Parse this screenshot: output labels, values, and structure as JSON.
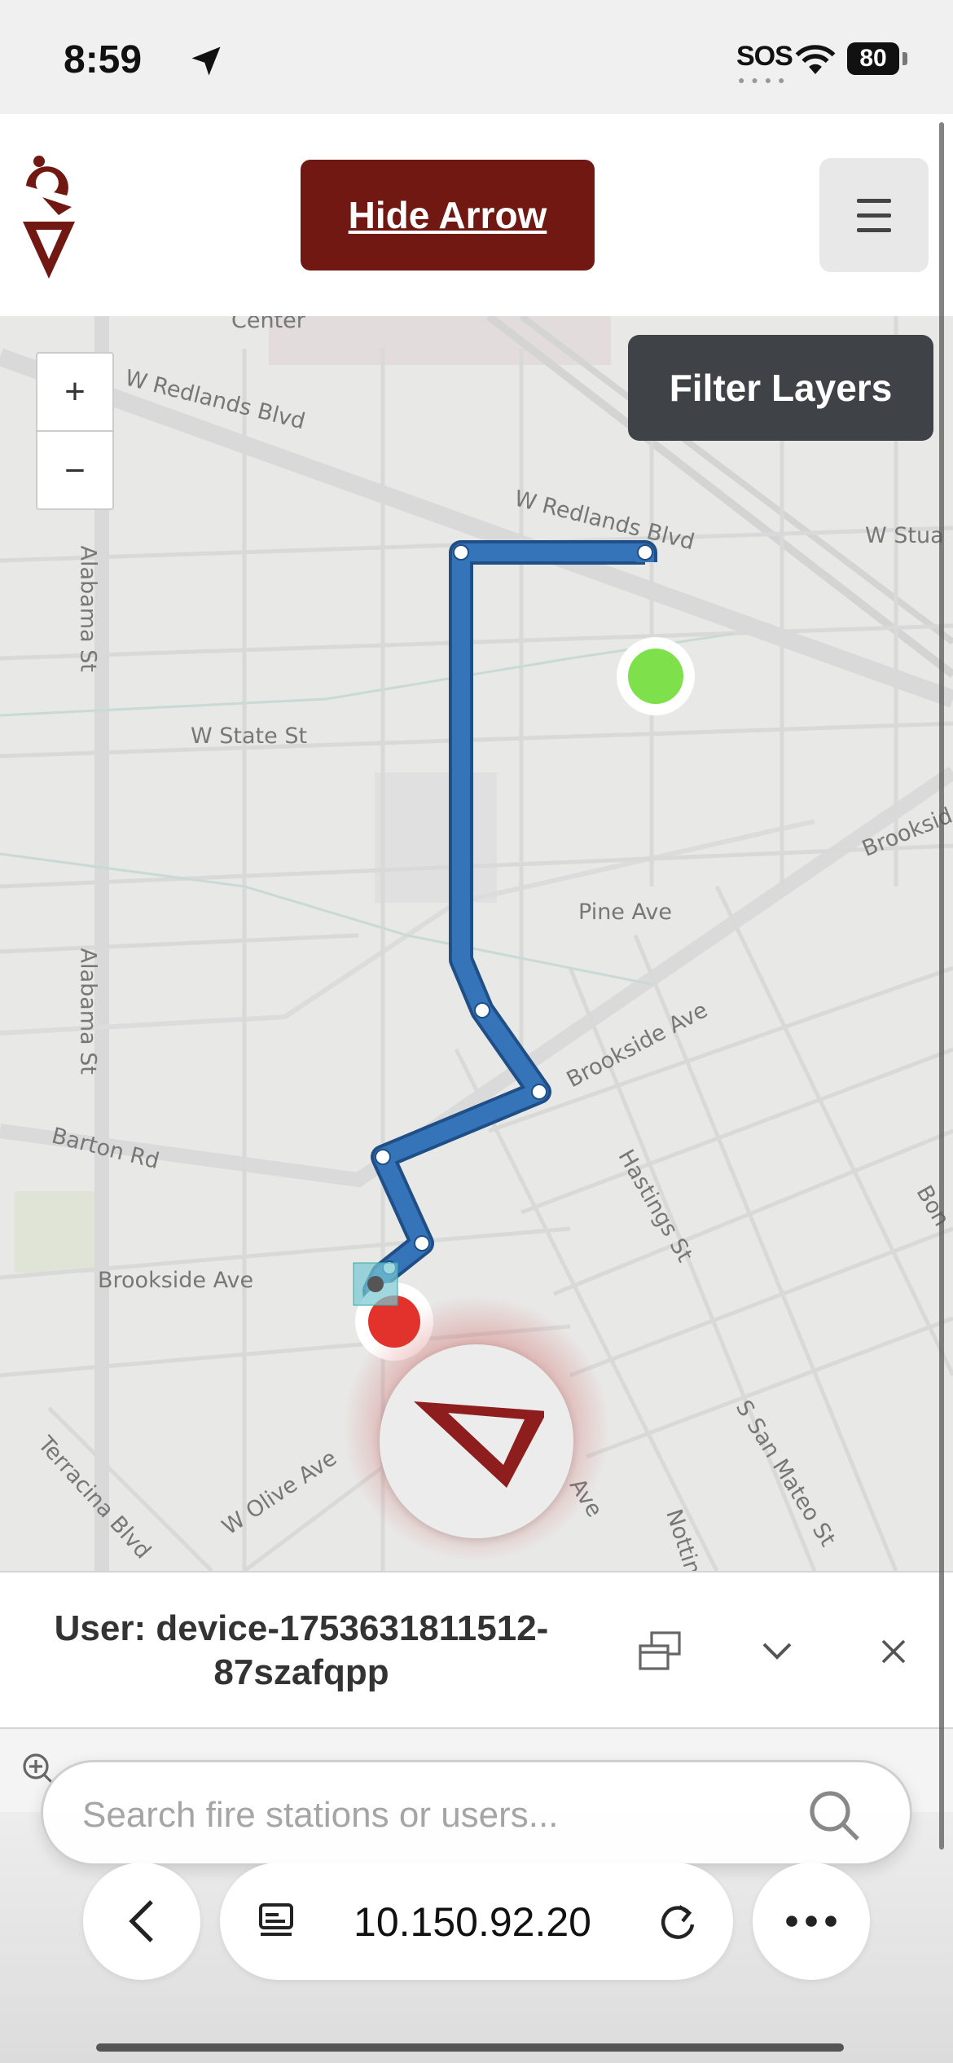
{
  "status_bar": {
    "time": "8:59",
    "sos": "SOS",
    "battery": "80"
  },
  "header": {
    "hide_arrow_label": "Hide Arrow"
  },
  "map": {
    "filter_label": "Filter Layers",
    "zoom_in": "+",
    "zoom_out": "−",
    "streets": {
      "s1": "W Redlands Blvd",
      "s2": "W Redlands Blvd",
      "s3": "W Stua",
      "s4": "Alabama St",
      "s5": "W State St",
      "s6": "Brooksid",
      "s7": "Pine Ave",
      "s8": "Alabama St",
      "s9": "Brookside Ave",
      "s10": "Barton Rd",
      "s11": "Hastings St",
      "s12": "Bon",
      "s13": "Brookside Ave",
      "s14": "Terracina Blvd",
      "s15": "W Olive Ave",
      "s16": "Ave",
      "s17": "Nottin",
      "s18": "S San Mateo St",
      "s19": "Center"
    },
    "route_color": "#3574b8",
    "start_color": "#7ee04a",
    "end_color": "#e3322b"
  },
  "panel": {
    "user_title": "User: device-1753631811512-87szafqpp"
  },
  "search": {
    "placeholder": "Search fire stations or users..."
  },
  "browser": {
    "url": "10.150.92.20"
  },
  "colors": {
    "accent": "#721812",
    "filter_bg": "#3f4246"
  }
}
